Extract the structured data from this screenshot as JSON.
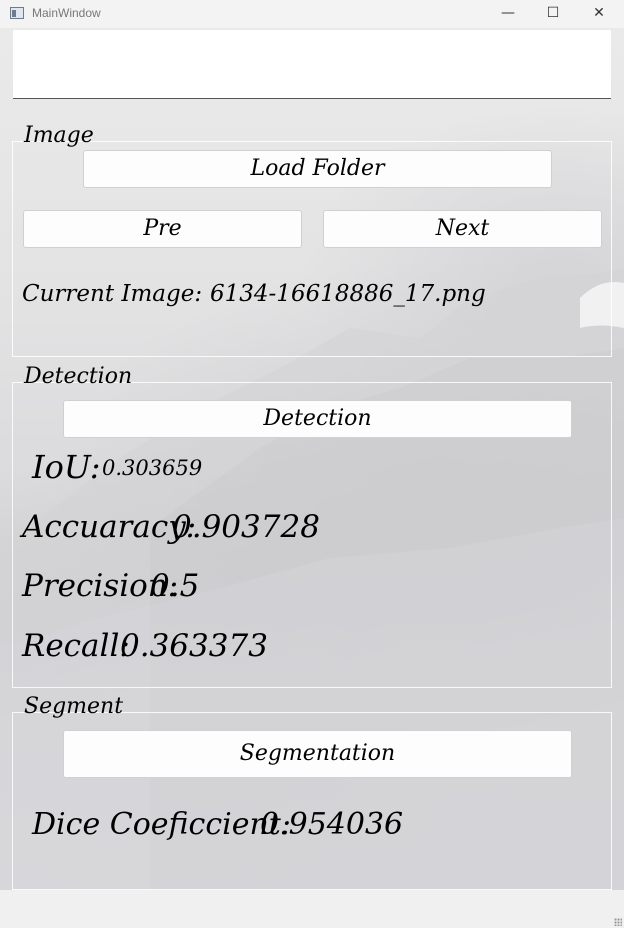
{
  "window": {
    "title": "MainWindow",
    "minimize": "—",
    "maximize": "☐",
    "close": "✕"
  },
  "image_group": {
    "title": "Image",
    "load_folder_label": "Load Folder",
    "pre_label": "Pre",
    "next_label": "Next",
    "current_image_label": "Current Image:",
    "current_image_value": "6134-16618886_17.png"
  },
  "detection_group": {
    "title": "Detection",
    "detection_label": "Detection",
    "iou_label": "IoU:",
    "iou_value": "0.303659",
    "accuracy_label": "Accuaracy:",
    "accuracy_value": "0.903728",
    "precision_label": "Precision:",
    "precision_value": "0.5",
    "recall_label": "Recall:",
    "recall_value": "0.363373"
  },
  "segment_group": {
    "title": "Segment",
    "segmentation_label": "Segmentation",
    "dice_label": "Dice Coeficcient:",
    "dice_value": "0.954036"
  }
}
